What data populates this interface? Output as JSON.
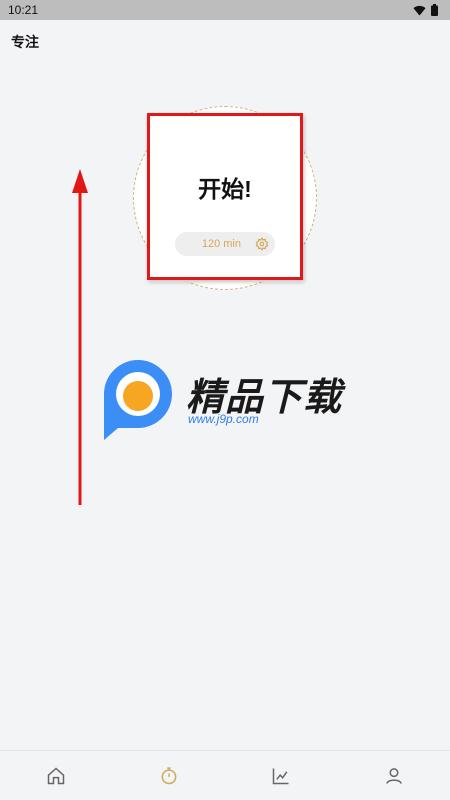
{
  "status_bar": {
    "time": "10:21"
  },
  "page": {
    "title": "专注"
  },
  "timer": {
    "start_label": "开始!",
    "duration": "120 min"
  },
  "watermark": {
    "title": "精品下载",
    "url": "www.j9p.com"
  },
  "colors": {
    "accent": "#d3a85a",
    "annotation_red": "#e01818",
    "watermark_blue": "#2f7fe8",
    "watermark_orange": "#f6a623"
  },
  "bottom_nav": {
    "items": [
      {
        "icon": "home-icon"
      },
      {
        "icon": "timer-icon",
        "active": true
      },
      {
        "icon": "chart-icon"
      },
      {
        "icon": "profile-icon"
      }
    ]
  }
}
